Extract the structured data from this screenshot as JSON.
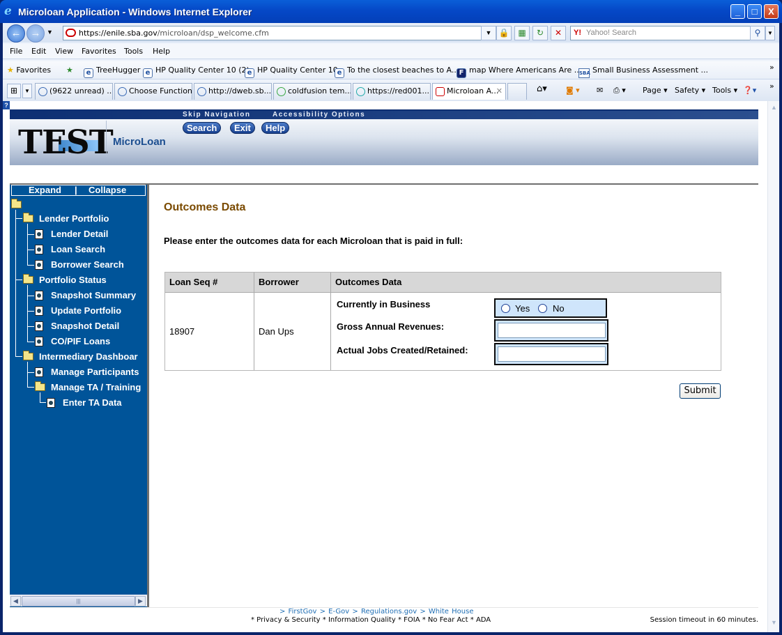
{
  "window": {
    "title": "Microloan Application - Windows Internet Explorer",
    "minimize": "_",
    "maximize": "□",
    "close": "X"
  },
  "address_bar": {
    "url_domain": "https://enile.sba.gov",
    "url_path": "/microloan/dsp_welcome.cfm",
    "search_placeholder": "Yahoo! Search",
    "search_logo": "Y!"
  },
  "menu": [
    "File",
    "Edit",
    "View",
    "Favorites",
    "Tools",
    "Help"
  ],
  "favorites_bar": {
    "label": "Favorites",
    "items": [
      "TreeHugger",
      "HP Quality Center 10 (2)",
      "HP Quality Center 10",
      "To the closest beaches to A...",
      "map Where Americans Are ...",
      "Small Business Assessment ..."
    ]
  },
  "tabs": [
    {
      "label": "(9622 unread) ..."
    },
    {
      "label": "Choose Function"
    },
    {
      "label": "http://dweb.sb..."
    },
    {
      "label": "coldfusion tem..."
    },
    {
      "label": "https://red001..."
    },
    {
      "label": "Microloan A...",
      "active": true
    }
  ],
  "command_bar": {
    "page": "Page",
    "safety": "Safety",
    "tools": "Tools"
  },
  "banner": {
    "skip_nav": "Skip Navigation",
    "accessibility": "Accessibility Options",
    "logo": "TEST",
    "app_name": "MicroLoan",
    "search_btn": "Search",
    "exit_btn": "Exit",
    "help_btn": "Help"
  },
  "sidebar": {
    "expand": "Expand",
    "divider": "|",
    "collapse": "Collapse",
    "tree": {
      "lender_portfolio": "Lender Portfolio",
      "lender_detail": "Lender Detail",
      "loan_search": "Loan Search",
      "borrower_search": "Borrower Search",
      "portfolio_status": "Portfolio Status",
      "snapshot_summary": "Snapshot Summary",
      "update_portfolio": "Update Portfolio",
      "snapshot_detail": "Snapshot Detail",
      "co_pif_loans": "CO/PIF Loans",
      "intermediary_dashboard": "Intermediary Dashboar",
      "manage_participants": "Manage Participants",
      "manage_ta_training": "Manage TA / Training",
      "enter_ta_data": "Enter TA Data"
    }
  },
  "main": {
    "title": "Outcomes Data",
    "instructions": "Please enter the outcomes data for each Microloan that is paid in full:",
    "table": {
      "headers": [
        "Loan Seq #",
        "Borrower",
        "Outcomes Data"
      ],
      "row": {
        "loan_seq": "18907",
        "borrower": "Dan Ups",
        "currently_in_business_label": "Currently in Business",
        "yes": "Yes",
        "no": "No",
        "gross_revenue_label": "Gross Annual Revenues:",
        "gross_revenue_value": "",
        "jobs_label": "Actual Jobs Created/Retained:",
        "jobs_value": ""
      }
    },
    "submit": "Submit"
  },
  "footer": {
    "links": [
      "> FirstGov",
      "> E-Gov",
      "> Regulations.gov",
      "> White House"
    ],
    "legal": [
      "* Privacy & Security",
      "* Information Quality",
      "* FOIA",
      "* No Fear Act",
      "* ADA"
    ],
    "timeout": "Session timeout in 60 minutes."
  },
  "colors": {
    "sidebar_bg": "#005499",
    "title_color": "#7a4a00",
    "highlight_box": "#cfe5fb"
  }
}
